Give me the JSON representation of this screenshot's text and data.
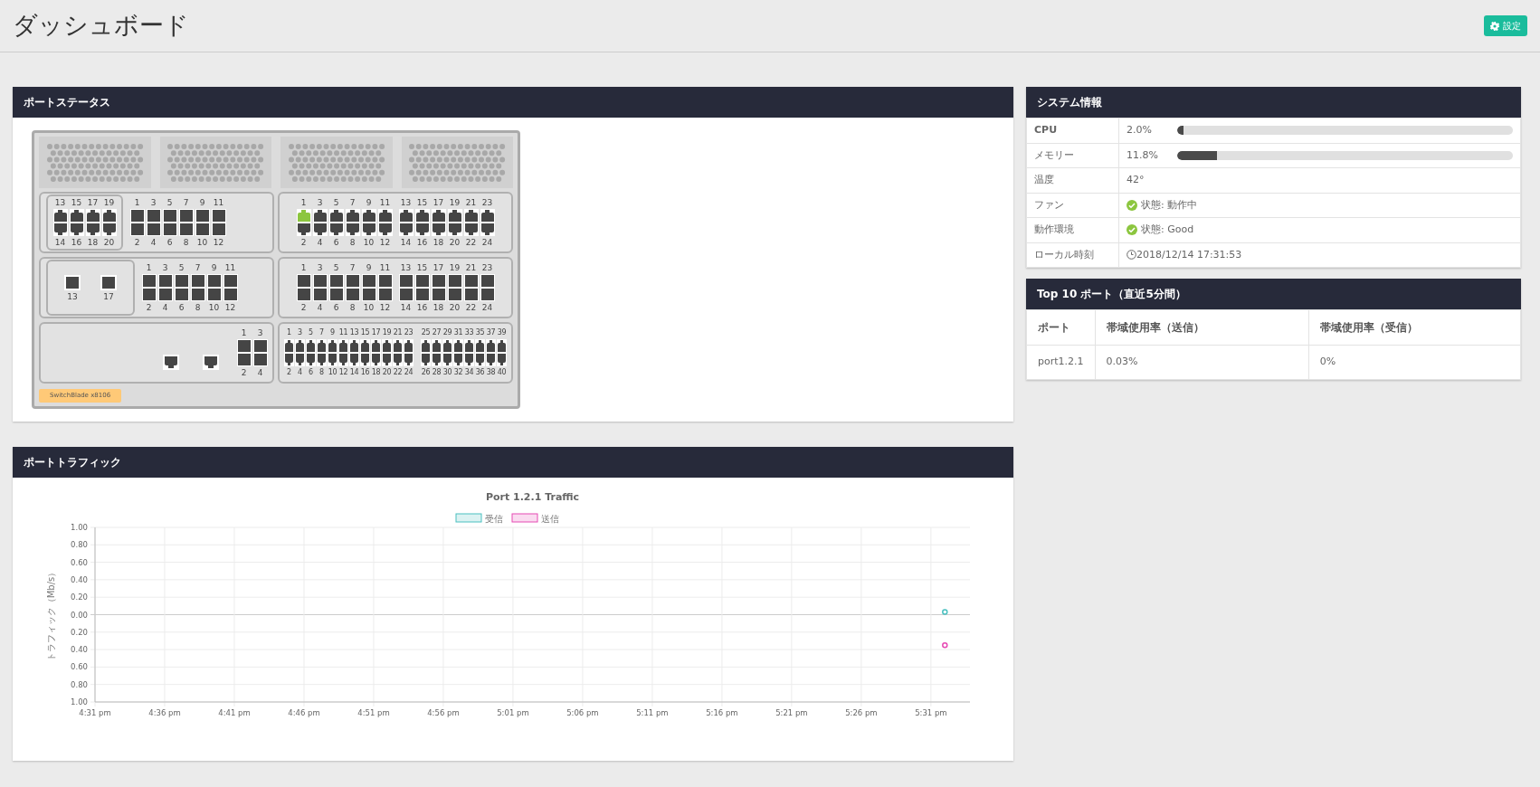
{
  "header": {
    "title": "ダッシュボード",
    "settings_button": "設定"
  },
  "port_status": {
    "title": "ポートステータス",
    "switch": {
      "model_label": "SwitchBlade x8106",
      "slot_rows": [
        {
          "left": [
            {
              "kind": "rj45framedpairs",
              "ports": [
                {
                  "label": "13",
                  "up": false
                },
                {
                  "label": "14",
                  "up": false
                },
                {
                  "label": "15",
                  "up": false
                },
                {
                  "label": "16",
                  "up": false
                },
                {
                  "label": "17",
                  "up": false
                },
                {
                  "label": "18",
                  "up": false
                },
                {
                  "label": "19",
                  "up": false
                },
                {
                  "label": "20",
                  "up": false
                }
              ]
            },
            {
              "kind": "sfppairs",
              "ports": [
                {
                  "label": "1",
                  "up": false
                },
                {
                  "label": "2",
                  "up": false
                },
                {
                  "label": "3",
                  "up": false
                },
                {
                  "label": "4",
                  "up": false
                },
                {
                  "label": "5",
                  "up": false
                },
                {
                  "label": "6",
                  "up": false
                },
                {
                  "label": "7",
                  "up": false
                },
                {
                  "label": "8",
                  "up": false
                },
                {
                  "label": "9",
                  "up": false
                },
                {
                  "label": "10",
                  "up": false
                },
                {
                  "label": "11",
                  "up": false
                },
                {
                  "label": "12",
                  "up": false
                }
              ]
            }
          ],
          "right": [
            {
              "kind": "rj45pairs",
              "ports": [
                {
                  "label": "1",
                  "up": true
                },
                {
                  "label": "2",
                  "up": false
                },
                {
                  "label": "3",
                  "up": false
                },
                {
                  "label": "4",
                  "up": false
                },
                {
                  "label": "5",
                  "up": false
                },
                {
                  "label": "6",
                  "up": false
                },
                {
                  "label": "7",
                  "up": false
                },
                {
                  "label": "8",
                  "up": false
                },
                {
                  "label": "9",
                  "up": false
                },
                {
                  "label": "10",
                  "up": false
                },
                {
                  "label": "11",
                  "up": false
                },
                {
                  "label": "12",
                  "up": false
                }
              ]
            },
            {
              "kind": "rj45pairs",
              "ports": [
                {
                  "label": "13",
                  "up": false
                },
                {
                  "label": "14",
                  "up": false
                },
                {
                  "label": "15",
                  "up": false
                },
                {
                  "label": "16",
                  "up": false
                },
                {
                  "label": "17",
                  "up": false
                },
                {
                  "label": "18",
                  "up": false
                },
                {
                  "label": "19",
                  "up": false
                },
                {
                  "label": "20",
                  "up": false
                },
                {
                  "label": "21",
                  "up": false
                },
                {
                  "label": "22",
                  "up": false
                },
                {
                  "label": "23",
                  "up": false
                },
                {
                  "label": "24",
                  "up": false
                }
              ]
            }
          ]
        },
        {
          "left": [
            {
              "kind": "sfpframedsingles",
              "ports": [
                {
                  "label": "13",
                  "up": false
                },
                {
                  "label": "17",
                  "up": false
                }
              ]
            },
            {
              "kind": "sfppairs",
              "ports": [
                {
                  "label": "1",
                  "up": false
                },
                {
                  "label": "2",
                  "up": false
                },
                {
                  "label": "3",
                  "up": false
                },
                {
                  "label": "4",
                  "up": false
                },
                {
                  "label": "5",
                  "up": false
                },
                {
                  "label": "6",
                  "up": false
                },
                {
                  "label": "7",
                  "up": false
                },
                {
                  "label": "8",
                  "up": false
                },
                {
                  "label": "9",
                  "up": false
                },
                {
                  "label": "10",
                  "up": false
                },
                {
                  "label": "11",
                  "up": false
                },
                {
                  "label": "12",
                  "up": false
                }
              ]
            }
          ],
          "right": [
            {
              "kind": "sfppairs",
              "ports": [
                {
                  "label": "1",
                  "up": false
                },
                {
                  "label": "2",
                  "up": false
                },
                {
                  "label": "3",
                  "up": false
                },
                {
                  "label": "4",
                  "up": false
                },
                {
                  "label": "5",
                  "up": false
                },
                {
                  "label": "6",
                  "up": false
                },
                {
                  "label": "7",
                  "up": false
                },
                {
                  "label": "8",
                  "up": false
                },
                {
                  "label": "9",
                  "up": false
                },
                {
                  "label": "10",
                  "up": false
                },
                {
                  "label": "11",
                  "up": false
                },
                {
                  "label": "12",
                  "up": false
                }
              ]
            },
            {
              "kind": "sfppairs",
              "ports": [
                {
                  "label": "13",
                  "up": false
                },
                {
                  "label": "14",
                  "up": false
                },
                {
                  "label": "15",
                  "up": false
                },
                {
                  "label": "16",
                  "up": false
                },
                {
                  "label": "17",
                  "up": false
                },
                {
                  "label": "18",
                  "up": false
                },
                {
                  "label": "19",
                  "up": false
                },
                {
                  "label": "20",
                  "up": false
                },
                {
                  "label": "21",
                  "up": false
                },
                {
                  "label": "22",
                  "up": false
                },
                {
                  "label": "23",
                  "up": false
                },
                {
                  "label": "24",
                  "up": false
                }
              ]
            }
          ]
        },
        {
          "left": [
            {
              "kind": "rj45singles",
              "ports": [
                {
                  "up": false
                },
                {
                  "up": false
                }
              ]
            },
            {
              "kind": "sfppairs",
              "ports": [
                {
                  "label": "1",
                  "up": false
                },
                {
                  "label": "2",
                  "up": false
                },
                {
                  "label": "3",
                  "up": false
                },
                {
                  "label": "4",
                  "up": false
                }
              ]
            }
          ],
          "right": [
            {
              "kind": "rj45pairs",
              "ports": [
                {
                  "label": "1",
                  "up": false
                },
                {
                  "label": "2",
                  "up": false
                },
                {
                  "label": "3",
                  "up": false
                },
                {
                  "label": "4",
                  "up": false
                },
                {
                  "label": "5",
                  "up": false
                },
                {
                  "label": "6",
                  "up": false
                },
                {
                  "label": "7",
                  "up": false
                },
                {
                  "label": "8",
                  "up": false
                },
                {
                  "label": "9",
                  "up": false
                },
                {
                  "label": "10",
                  "up": false
                },
                {
                  "label": "11",
                  "up": false
                },
                {
                  "label": "12",
                  "up": false
                },
                {
                  "label": "13",
                  "up": false
                },
                {
                  "label": "14",
                  "up": false
                },
                {
                  "label": "15",
                  "up": false
                },
                {
                  "label": "16",
                  "up": false
                },
                {
                  "label": "17",
                  "up": false
                },
                {
                  "label": "18",
                  "up": false
                },
                {
                  "label": "19",
                  "up": false
                },
                {
                  "label": "20",
                  "up": false
                },
                {
                  "label": "21",
                  "up": false
                },
                {
                  "label": "22",
                  "up": false
                },
                {
                  "label": "23",
                  "up": false
                },
                {
                  "label": "24",
                  "up": false
                }
              ]
            },
            {
              "kind": "rj45pairs",
              "ports": [
                {
                  "label": "25",
                  "up": false
                },
                {
                  "label": "26",
                  "up": false
                },
                {
                  "label": "27",
                  "up": false
                },
                {
                  "label": "28",
                  "up": false
                },
                {
                  "label": "29",
                  "up": false
                },
                {
                  "label": "30",
                  "up": false
                },
                {
                  "label": "31",
                  "up": false
                },
                {
                  "label": "32",
                  "up": false
                },
                {
                  "label": "33",
                  "up": false
                },
                {
                  "label": "34",
                  "up": false
                },
                {
                  "label": "35",
                  "up": false
                },
                {
                  "label": "36",
                  "up": false
                },
                {
                  "label": "37",
                  "up": false
                },
                {
                  "label": "38",
                  "up": false
                },
                {
                  "label": "39",
                  "up": false
                },
                {
                  "label": "40",
                  "up": false
                }
              ]
            }
          ]
        }
      ]
    }
  },
  "port_traffic": {
    "title": "ポートトラフィック",
    "chart_data": {
      "type": "scatter",
      "grid": true,
      "legend": "top",
      "title": "Port 1.2.1 Traffic",
      "ylabel": "トラフィック（Mb/s）",
      "categories": [
        "4:31 pm",
        null,
        null,
        null,
        null,
        "4:36 pm",
        null,
        null,
        null,
        null,
        "4:41 pm",
        null,
        null,
        null,
        null,
        "4:46 pm",
        null,
        null,
        null,
        null,
        "4:51 pm",
        null,
        null,
        null,
        null,
        "4:56 pm",
        null,
        null,
        null,
        null,
        "5:01 pm",
        null,
        null,
        null,
        null,
        "5:06 pm",
        null,
        null,
        null,
        null,
        "5:11 pm",
        null,
        null,
        null,
        null,
        "5:16 pm",
        null,
        null,
        null,
        null,
        "5:21 pm",
        null,
        null,
        null,
        null,
        "5:26 pm",
        null,
        null,
        null,
        null,
        "5:31 pm",
        null,
        null
      ],
      "series": [
        {
          "name": "受信",
          "color": "#4bc0c0",
          "values": [
            null,
            null,
            null,
            null,
            null,
            null,
            null,
            null,
            null,
            null,
            null,
            null,
            null,
            null,
            null,
            null,
            null,
            null,
            null,
            null,
            null,
            null,
            null,
            null,
            null,
            null,
            null,
            null,
            null,
            null,
            null,
            null,
            null,
            null,
            null,
            null,
            null,
            null,
            null,
            null,
            null,
            null,
            null,
            null,
            null,
            null,
            null,
            null,
            null,
            null,
            null,
            null,
            null,
            null,
            null,
            null,
            null,
            null,
            null,
            null,
            null,
            0.03,
            null
          ]
        },
        {
          "name": "送信",
          "color": "#e64bb4",
          "values": [
            null,
            null,
            null,
            null,
            null,
            null,
            null,
            null,
            null,
            null,
            null,
            null,
            null,
            null,
            null,
            null,
            null,
            null,
            null,
            null,
            null,
            null,
            null,
            null,
            null,
            null,
            null,
            null,
            null,
            null,
            null,
            null,
            null,
            null,
            null,
            null,
            null,
            null,
            null,
            null,
            null,
            null,
            null,
            null,
            null,
            null,
            null,
            null,
            null,
            null,
            null,
            null,
            null,
            null,
            null,
            null,
            null,
            null,
            null,
            null,
            null,
            -0.35,
            null
          ]
        }
      ],
      "ylim": [
        -1,
        1
      ],
      "yticks": [
        {
          "value": 1,
          "label": "1.00"
        },
        {
          "value": 0.8,
          "label": "0.80"
        },
        {
          "value": 0.6,
          "label": "0.60"
        },
        {
          "value": 0.4,
          "label": "0.40"
        },
        {
          "value": 0.2,
          "label": "0.20"
        },
        {
          "value": 0,
          "label": "0.00"
        },
        {
          "value": -0.2,
          "label": "0.20"
        },
        {
          "value": -0.4,
          "label": "0.40"
        },
        {
          "value": -0.6,
          "label": "0.60"
        },
        {
          "value": -0.8,
          "label": "0.80"
        },
        {
          "value": -1,
          "label": "1.00"
        }
      ]
    }
  },
  "system_info": {
    "title": "システム情報",
    "rows": [
      {
        "kind": "bar",
        "label": "CPU",
        "value": "2.0%",
        "level": 0.02
      },
      {
        "kind": "bar",
        "label": "メモリー",
        "value": "11.8%",
        "level": 0.118
      },
      {
        "kind": "text",
        "label": "温度",
        "value": "42°"
      },
      {
        "kind": "status",
        "label": "ファン",
        "value": "状態: 動作中"
      },
      {
        "kind": "status",
        "label": "動作環境",
        "value": "状態: Good"
      },
      {
        "kind": "time",
        "label": "ローカル時刻",
        "value": "2018/12/14 17:31:53"
      }
    ]
  },
  "top_ports": {
    "title": "Top 10 ポート（直近5分間）",
    "columns": [
      "ポート",
      "帯域使用率（送信）",
      "帯域使用率（受信）"
    ],
    "rows": [
      [
        "port1.2.1",
        "0.03%",
        "0%"
      ]
    ]
  }
}
